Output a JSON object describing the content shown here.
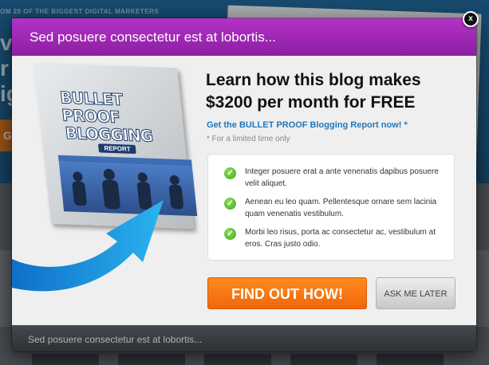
{
  "background": {
    "tagline": "OM 20 OF THE BIGGEST DIGITAL MARKETERS",
    "letters": [
      "v",
      "r",
      "ig"
    ],
    "button_letter": "G"
  },
  "modal": {
    "top_title": "Sed posuere consectetur est at lobortis...",
    "footer_text": "Sed posuere consectetur est at lobortis...",
    "close_label": "x"
  },
  "book": {
    "title_line1": "BULLET",
    "title_line2": "PROOF",
    "title_line3": "BLOGGING",
    "badge": "REPORT"
  },
  "content": {
    "headline": "Learn how this blog makes $3200 per month for FREE",
    "subhead": "Get the BULLET PROOF Blogging Report now! *",
    "note": "* For a limited time only",
    "benefits": [
      "Integer posuere erat a ante venenatis dapibus posuere velit aliquet.",
      "Aenean eu leo quam. Pellentesque ornare sem lacinia quam venenatis vestibulum.",
      "Morbi leo risus, porta ac consectetur ac, vestibulum at eros. Cras justo odio."
    ],
    "cta_label": "FIND OUT HOW!",
    "later_label": "ASK ME LATER"
  },
  "colors": {
    "header_purple": "#9b27b0",
    "cta_orange": "#f57a12",
    "link_blue": "#1f78bf",
    "check_green": "#3ea51d"
  }
}
